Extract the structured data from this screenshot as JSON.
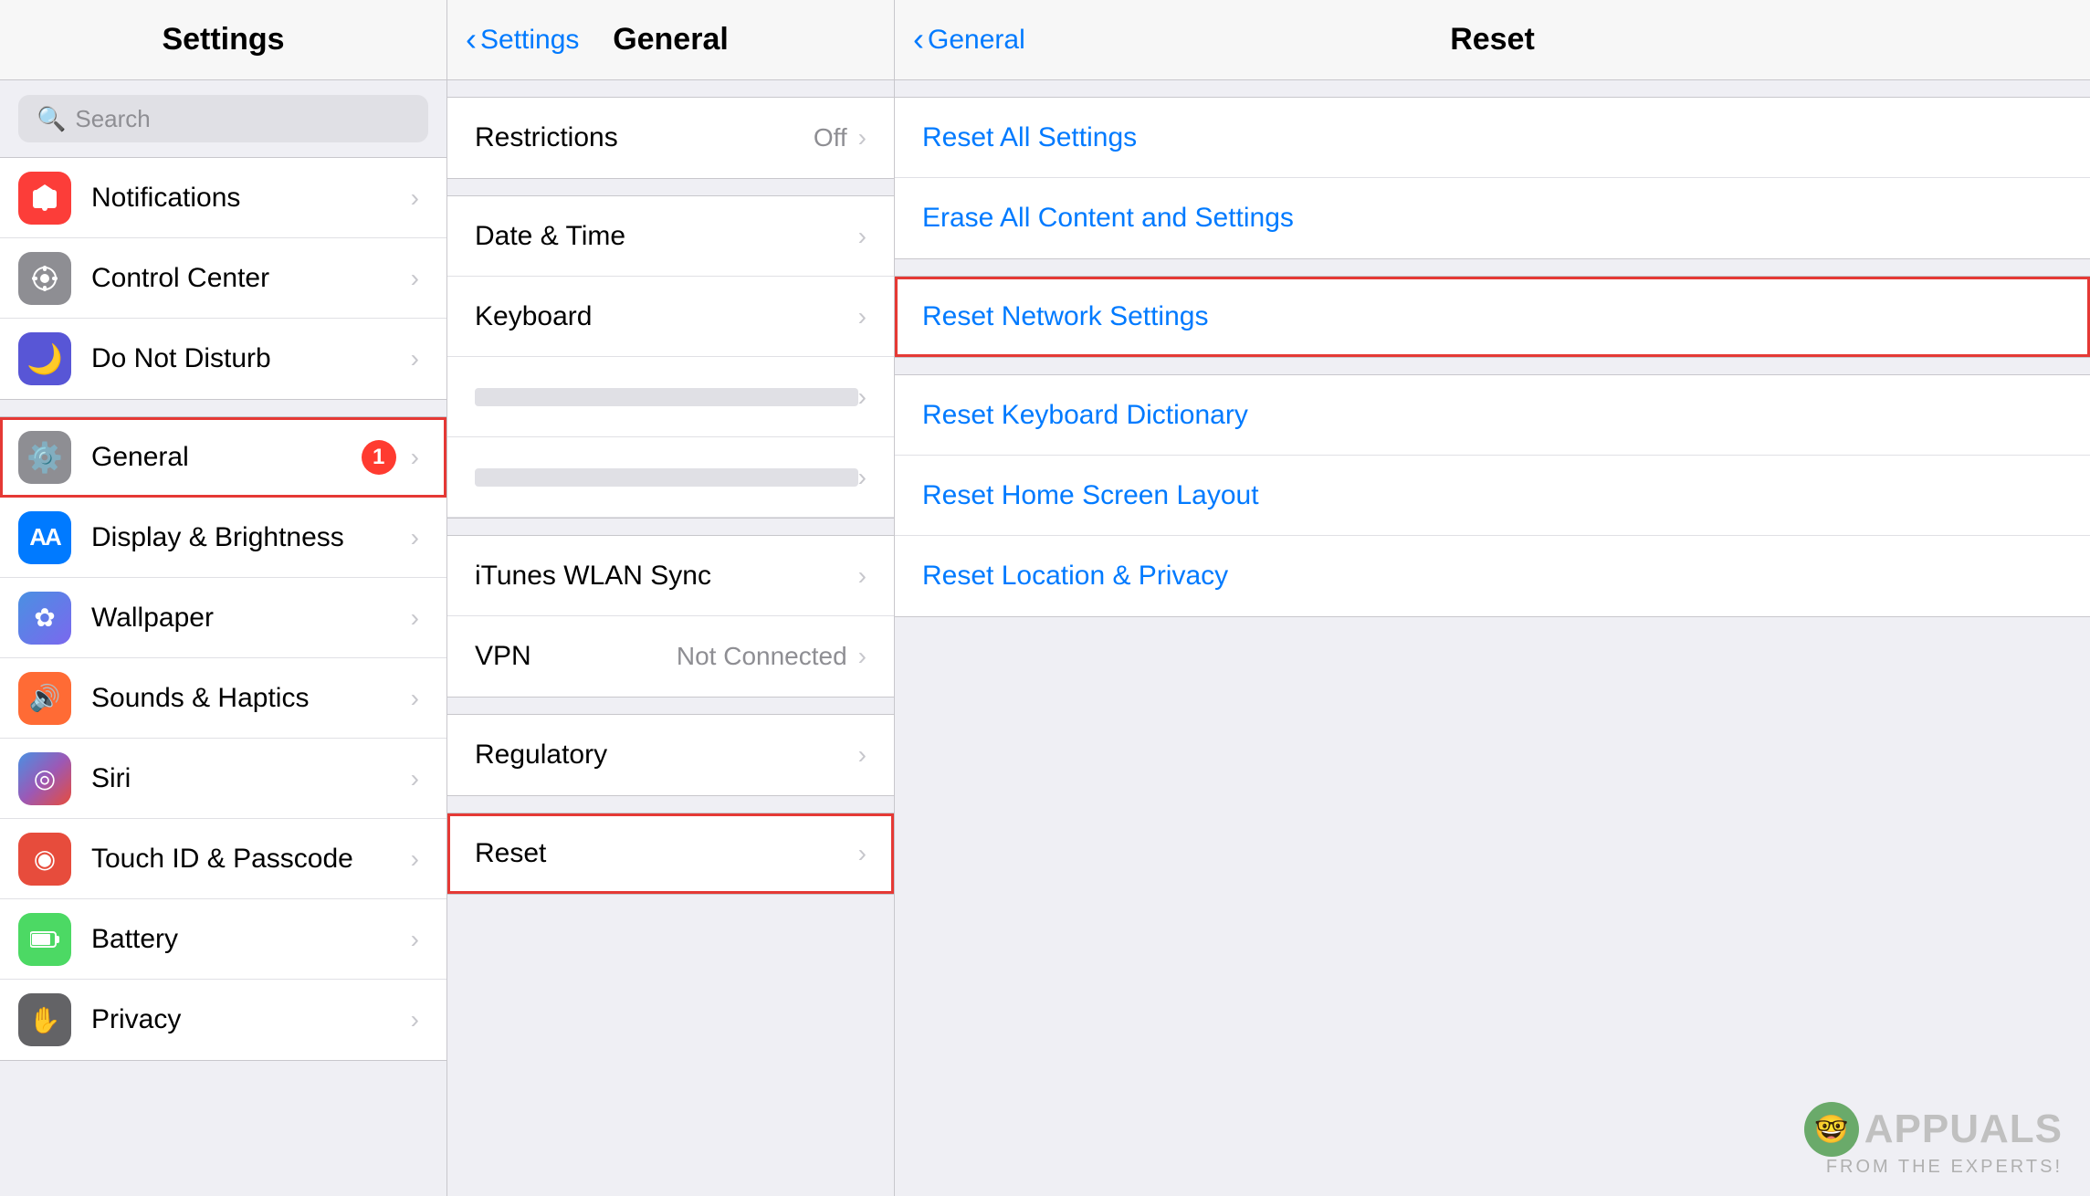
{
  "left_panel": {
    "title": "Settings",
    "search_placeholder": "Search",
    "items": [
      {
        "id": "notifications",
        "label": "Notifications",
        "icon_class": "icon-red",
        "icon_symbol": "🔔",
        "selected": false
      },
      {
        "id": "control-center",
        "label": "Control Center",
        "icon_class": "icon-gray",
        "icon_symbol": "⊞",
        "selected": false
      },
      {
        "id": "do-not-disturb",
        "label": "Do Not Disturb",
        "icon_class": "icon-purple",
        "icon_symbol": "🌙",
        "selected": false
      },
      {
        "id": "general",
        "label": "General",
        "icon_class": "icon-general",
        "icon_symbol": "⚙",
        "badge": "1",
        "selected": true
      },
      {
        "id": "display-brightness",
        "label": "Display & Brightness",
        "icon_class": "icon-blue-aa",
        "icon_symbol": "AA",
        "selected": false
      },
      {
        "id": "wallpaper",
        "label": "Wallpaper",
        "icon_class": "icon-blue-wallpaper",
        "icon_symbol": "✿",
        "selected": false
      },
      {
        "id": "sounds-haptics",
        "label": "Sounds & Haptics",
        "icon_class": "icon-orange-sounds",
        "icon_symbol": "🔊",
        "selected": false
      },
      {
        "id": "siri",
        "label": "Siri",
        "icon_class": "icon-siri",
        "icon_symbol": "◎",
        "selected": false
      },
      {
        "id": "touch-id-passcode",
        "label": "Touch ID & Passcode",
        "icon_class": "icon-touch-id",
        "icon_symbol": "◉",
        "selected": false
      },
      {
        "id": "battery",
        "label": "Battery",
        "icon_class": "icon-battery",
        "icon_symbol": "▮",
        "selected": false
      },
      {
        "id": "privacy",
        "label": "Privacy",
        "icon_class": "icon-privacy",
        "icon_symbol": "✋",
        "selected": false
      }
    ]
  },
  "middle_panel": {
    "back_label": "Settings",
    "title": "General",
    "items_group1": [
      {
        "id": "restrictions",
        "label": "Restrictions",
        "value": "Off"
      }
    ],
    "items_group2": [
      {
        "id": "date-time",
        "label": "Date & Time"
      },
      {
        "id": "keyboard",
        "label": "Keyboard"
      },
      {
        "id": "blurred1",
        "label": ""
      },
      {
        "id": "blurred2",
        "label": ""
      }
    ],
    "items_group3": [
      {
        "id": "itunes-wlan",
        "label": "iTunes WLAN Sync"
      },
      {
        "id": "vpn",
        "label": "VPN",
        "value": "Not Connected"
      }
    ],
    "items_group4": [
      {
        "id": "regulatory",
        "label": "Regulatory"
      }
    ],
    "items_group5": [
      {
        "id": "reset",
        "label": "Reset",
        "highlighted": true
      }
    ]
  },
  "right_panel": {
    "back_label": "General",
    "title": "Reset",
    "items_group1": [
      {
        "id": "reset-all-settings",
        "label": "Reset All Settings"
      },
      {
        "id": "erase-all",
        "label": "Erase All Content and Settings"
      }
    ],
    "items_group2": [
      {
        "id": "reset-network",
        "label": "Reset Network Settings",
        "highlighted": true
      }
    ],
    "items_group3": [
      {
        "id": "reset-keyboard",
        "label": "Reset Keyboard Dictionary"
      },
      {
        "id": "reset-home-screen",
        "label": "Reset Home Screen Layout"
      },
      {
        "id": "reset-location",
        "label": "Reset Location & Privacy"
      }
    ]
  },
  "watermark": {
    "logo": "A??PUALS",
    "sub": "FROM THE EXPERTS!"
  }
}
